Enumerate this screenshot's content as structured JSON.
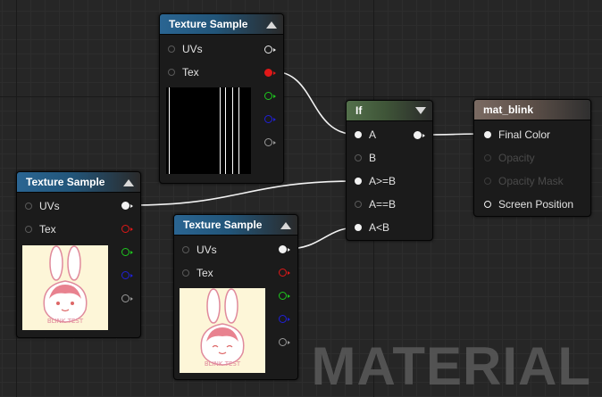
{
  "nodes": {
    "tex_top": {
      "title": "Texture Sample",
      "pins": {
        "uvs": "UVs",
        "tex": "Tex"
      }
    },
    "tex_left": {
      "title": "Texture Sample",
      "pins": {
        "uvs": "UVs",
        "tex": "Tex"
      },
      "preview_caption": "BLINK TEST"
    },
    "tex_mid": {
      "title": "Texture Sample",
      "pins": {
        "uvs": "UVs",
        "tex": "Tex"
      },
      "preview_caption": "BLINK TEST"
    },
    "if_node": {
      "title": "If",
      "pins": {
        "a": "A",
        "b": "B",
        "a_ge_b": "A>=B",
        "a_eq_b": "A==B",
        "a_lt_b": "A<B"
      }
    },
    "material": {
      "title": "mat_blink",
      "pins": {
        "final_color": "Final Color",
        "opacity": "Opacity",
        "opacity_mask": "Opacity Mask",
        "screen_position": "Screen Position"
      }
    }
  },
  "watermark": "MATERIAL",
  "colors": {
    "rgba_pin": "#e8e8e8",
    "r_pin": "#e01818",
    "g_pin": "#1ec81e",
    "b_pin": "#2020d8",
    "a_pin": "#9a9a9a",
    "wire": "#f2f2f2"
  }
}
